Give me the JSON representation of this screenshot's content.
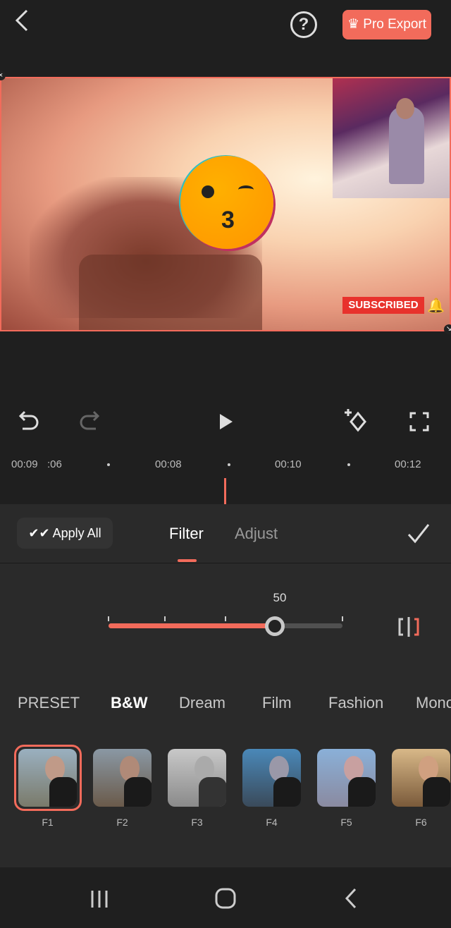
{
  "header": {
    "back_icon": "chevron-left-icon",
    "help_label": "?",
    "pro_export_label": "Pro Export",
    "pro_icon": "crown-icon"
  },
  "preview": {
    "sticker_text": "SUBSCRIBED",
    "emoji": "kissing-winking-face"
  },
  "controls": {
    "undo": "undo-icon",
    "redo": "redo-icon",
    "play": "play-icon",
    "keyframe": "add-keyframe-icon",
    "fullscreen": "fullscreen-icon"
  },
  "timeline": {
    "labels": [
      "00:09",
      ":06",
      "00:08",
      "00:10",
      "00:12"
    ]
  },
  "panel": {
    "apply_all_label": "Apply All",
    "tabs": [
      {
        "label": "Filter",
        "active": true
      },
      {
        "label": "Adjust",
        "active": false
      }
    ],
    "confirm_icon": "check-icon"
  },
  "slider": {
    "value": "50",
    "compare_icon": "compare-split-icon"
  },
  "categories": [
    {
      "label": "PRESET"
    },
    {
      "label": "B&W",
      "active": true
    },
    {
      "label": "Dream"
    },
    {
      "label": "Film"
    },
    {
      "label": "Fashion"
    },
    {
      "label": "Mono"
    }
  ],
  "filters": [
    {
      "label": "F1",
      "selected": true
    },
    {
      "label": "F2"
    },
    {
      "label": "F3"
    },
    {
      "label": "F4"
    },
    {
      "label": "F5"
    },
    {
      "label": "F6"
    }
  ],
  "accent_color": "#f26b5b",
  "navbar": {
    "recent": "recent-apps-icon",
    "home": "home-icon",
    "back": "back-icon"
  }
}
